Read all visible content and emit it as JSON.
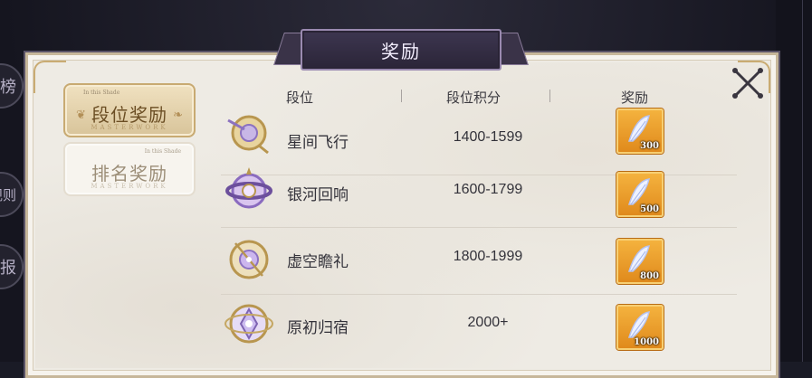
{
  "title": "奖励",
  "left_nav": [
    "榜",
    "规则",
    "报"
  ],
  "tabs": [
    {
      "label": "段位奖励",
      "tiny_left": "In this Shade",
      "tiny_right": "",
      "sub": "MASTERWORK",
      "active": true
    },
    {
      "label": "排名奖励",
      "tiny_left": "",
      "tiny_right": "In this Shade",
      "sub": "MASTERWORK",
      "active": false
    }
  ],
  "columns": {
    "rank": "段位",
    "score": "段位积分",
    "reward": "奖励"
  },
  "rows": [
    {
      "rank": "星间飞行",
      "score": "1400-1599",
      "reward_qty": "300"
    },
    {
      "rank": "银河回响",
      "score": "1600-1799",
      "reward_qty": "500"
    },
    {
      "rank": "虚空瞻礼",
      "score": "1800-1999",
      "reward_qty": "800"
    },
    {
      "rank": "原初归宿",
      "score": "2000+",
      "reward_qty": "1000"
    }
  ],
  "icons": {
    "close": "close-x-icon",
    "reward": "crystal-feather-icon",
    "rank": "rank-emblem-icon"
  }
}
